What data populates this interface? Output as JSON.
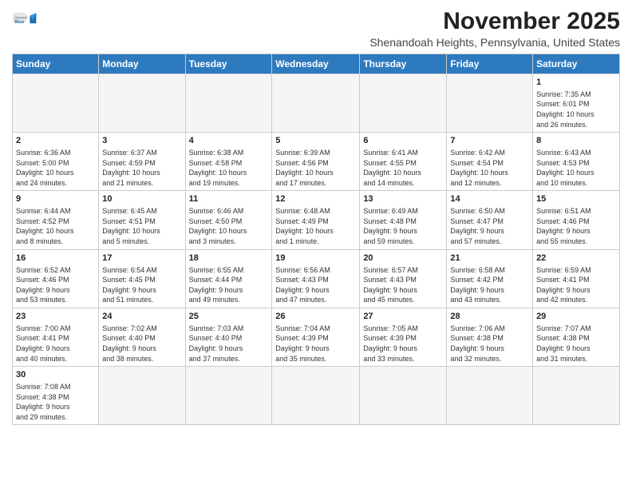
{
  "header": {
    "logo_general": "General",
    "logo_blue": "Blue",
    "month_year": "November 2025",
    "location": "Shenandoah Heights, Pennsylvania, United States"
  },
  "days_of_week": [
    "Sunday",
    "Monday",
    "Tuesday",
    "Wednesday",
    "Thursday",
    "Friday",
    "Saturday"
  ],
  "weeks": [
    [
      {
        "day": "",
        "info": "",
        "empty": true
      },
      {
        "day": "",
        "info": "",
        "empty": true
      },
      {
        "day": "",
        "info": "",
        "empty": true
      },
      {
        "day": "",
        "info": "",
        "empty": true
      },
      {
        "day": "",
        "info": "",
        "empty": true
      },
      {
        "day": "",
        "info": "",
        "empty": true
      },
      {
        "day": "1",
        "info": "Sunrise: 7:35 AM\nSunset: 6:01 PM\nDaylight: 10 hours\nand 26 minutes."
      }
    ],
    [
      {
        "day": "2",
        "info": "Sunrise: 6:36 AM\nSunset: 5:00 PM\nDaylight: 10 hours\nand 24 minutes."
      },
      {
        "day": "3",
        "info": "Sunrise: 6:37 AM\nSunset: 4:59 PM\nDaylight: 10 hours\nand 21 minutes."
      },
      {
        "day": "4",
        "info": "Sunrise: 6:38 AM\nSunset: 4:58 PM\nDaylight: 10 hours\nand 19 minutes."
      },
      {
        "day": "5",
        "info": "Sunrise: 6:39 AM\nSunset: 4:56 PM\nDaylight: 10 hours\nand 17 minutes."
      },
      {
        "day": "6",
        "info": "Sunrise: 6:41 AM\nSunset: 4:55 PM\nDaylight: 10 hours\nand 14 minutes."
      },
      {
        "day": "7",
        "info": "Sunrise: 6:42 AM\nSunset: 4:54 PM\nDaylight: 10 hours\nand 12 minutes."
      },
      {
        "day": "8",
        "info": "Sunrise: 6:43 AM\nSunset: 4:53 PM\nDaylight: 10 hours\nand 10 minutes."
      }
    ],
    [
      {
        "day": "9",
        "info": "Sunrise: 6:44 AM\nSunset: 4:52 PM\nDaylight: 10 hours\nand 8 minutes."
      },
      {
        "day": "10",
        "info": "Sunrise: 6:45 AM\nSunset: 4:51 PM\nDaylight: 10 hours\nand 5 minutes."
      },
      {
        "day": "11",
        "info": "Sunrise: 6:46 AM\nSunset: 4:50 PM\nDaylight: 10 hours\nand 3 minutes."
      },
      {
        "day": "12",
        "info": "Sunrise: 6:48 AM\nSunset: 4:49 PM\nDaylight: 10 hours\nand 1 minute."
      },
      {
        "day": "13",
        "info": "Sunrise: 6:49 AM\nSunset: 4:48 PM\nDaylight: 9 hours\nand 59 minutes."
      },
      {
        "day": "14",
        "info": "Sunrise: 6:50 AM\nSunset: 4:47 PM\nDaylight: 9 hours\nand 57 minutes."
      },
      {
        "day": "15",
        "info": "Sunrise: 6:51 AM\nSunset: 4:46 PM\nDaylight: 9 hours\nand 55 minutes."
      }
    ],
    [
      {
        "day": "16",
        "info": "Sunrise: 6:52 AM\nSunset: 4:46 PM\nDaylight: 9 hours\nand 53 minutes."
      },
      {
        "day": "17",
        "info": "Sunrise: 6:54 AM\nSunset: 4:45 PM\nDaylight: 9 hours\nand 51 minutes."
      },
      {
        "day": "18",
        "info": "Sunrise: 6:55 AM\nSunset: 4:44 PM\nDaylight: 9 hours\nand 49 minutes."
      },
      {
        "day": "19",
        "info": "Sunrise: 6:56 AM\nSunset: 4:43 PM\nDaylight: 9 hours\nand 47 minutes."
      },
      {
        "day": "20",
        "info": "Sunrise: 6:57 AM\nSunset: 4:43 PM\nDaylight: 9 hours\nand 45 minutes."
      },
      {
        "day": "21",
        "info": "Sunrise: 6:58 AM\nSunset: 4:42 PM\nDaylight: 9 hours\nand 43 minutes."
      },
      {
        "day": "22",
        "info": "Sunrise: 6:59 AM\nSunset: 4:41 PM\nDaylight: 9 hours\nand 42 minutes."
      }
    ],
    [
      {
        "day": "23",
        "info": "Sunrise: 7:00 AM\nSunset: 4:41 PM\nDaylight: 9 hours\nand 40 minutes."
      },
      {
        "day": "24",
        "info": "Sunrise: 7:02 AM\nSunset: 4:40 PM\nDaylight: 9 hours\nand 38 minutes."
      },
      {
        "day": "25",
        "info": "Sunrise: 7:03 AM\nSunset: 4:40 PM\nDaylight: 9 hours\nand 37 minutes."
      },
      {
        "day": "26",
        "info": "Sunrise: 7:04 AM\nSunset: 4:39 PM\nDaylight: 9 hours\nand 35 minutes."
      },
      {
        "day": "27",
        "info": "Sunrise: 7:05 AM\nSunset: 4:39 PM\nDaylight: 9 hours\nand 33 minutes."
      },
      {
        "day": "28",
        "info": "Sunrise: 7:06 AM\nSunset: 4:38 PM\nDaylight: 9 hours\nand 32 minutes."
      },
      {
        "day": "29",
        "info": "Sunrise: 7:07 AM\nSunset: 4:38 PM\nDaylight: 9 hours\nand 31 minutes."
      }
    ],
    [
      {
        "day": "30",
        "info": "Sunrise: 7:08 AM\nSunset: 4:38 PM\nDaylight: 9 hours\nand 29 minutes."
      },
      {
        "day": "",
        "info": "",
        "empty": true
      },
      {
        "day": "",
        "info": "",
        "empty": true
      },
      {
        "day": "",
        "info": "",
        "empty": true
      },
      {
        "day": "",
        "info": "",
        "empty": true
      },
      {
        "day": "",
        "info": "",
        "empty": true
      },
      {
        "day": "",
        "info": "",
        "empty": true
      }
    ]
  ]
}
